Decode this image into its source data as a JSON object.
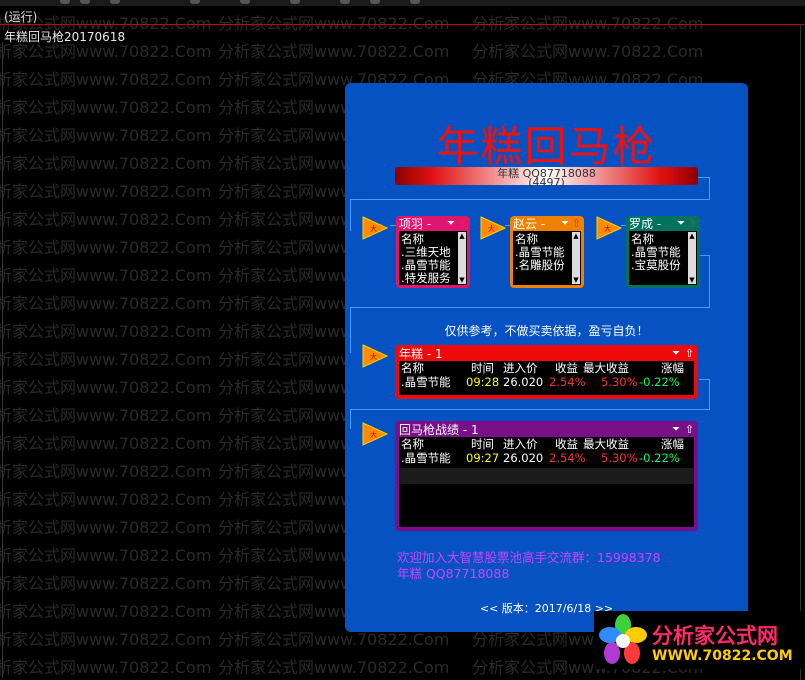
{
  "window": {
    "status": "(运行)",
    "formula_title": "年糕回马枪20170618"
  },
  "watermark": {
    "text": "分析家公式网www.70822.Com"
  },
  "panel": {
    "title": "年糕回马枪",
    "author_line1": "年糕 QQ87718088",
    "author_line2": "(4497)",
    "disclaimer": "仅供参考，不做买卖依据，盈亏自负！",
    "join_line1": "欢迎加入大智慧股票池高手交流群：15998378",
    "join_line2": "年糕 QQ87718088",
    "version": "<< 版本：2017/6/18 >>"
  },
  "mini_windows": [
    {
      "title": "项羽 -",
      "header": "名称",
      "rows": [
        ".三维天地",
        ".晶雪节能",
        ".特发服务"
      ],
      "color": "#e0166e"
    },
    {
      "title": "赵云 -",
      "header": "名称",
      "rows": [
        ".晶雪节能",
        ".名雕股份"
      ],
      "color": "#f08000"
    },
    {
      "title": "罗成 -",
      "header": "名称",
      "rows": [
        ".晶雪节能",
        ".宝莫股份"
      ],
      "color": "#00735e"
    }
  ],
  "result_windows": [
    {
      "title": "年糕 - 1",
      "color": "#ee0a0a",
      "columns": [
        "名称",
        "时间",
        "进入价",
        "收益",
        "最大收益",
        "涨幅"
      ],
      "rows": [
        [
          ".晶雪节能",
          "09:28",
          "26.020",
          "2.54%",
          "5.30%",
          "-0.22%"
        ]
      ]
    },
    {
      "title": "回马枪战绩 - 1",
      "color": "#7a0f8a",
      "columns": [
        "名称",
        "时间",
        "进入价",
        "收益",
        "最大收益",
        "涨幅"
      ],
      "rows": [
        [
          ".晶雪节能",
          "09:27",
          "26.020",
          "2.54%",
          "5.30%",
          "-0.22%"
        ]
      ]
    }
  ],
  "logo": {
    "brand": "分析家公式网",
    "url": "WWW.70822.COM"
  },
  "colors": {
    "panel_bg": "#0652c2",
    "title_red": "#ee1111",
    "text_cyan": "#00ffff",
    "text_green": "#00ff66",
    "text_red": "#ff3030",
    "text_yellow": "#ffff00",
    "text_magenta": "#ff40ff",
    "join_purple": "#d040ff"
  }
}
